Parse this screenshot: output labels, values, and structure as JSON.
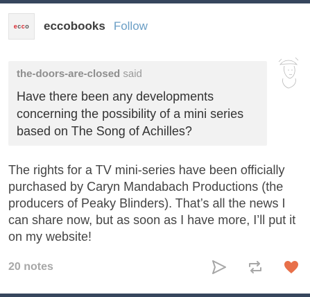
{
  "post": {
    "blog_name": "eccobooks",
    "follow_label": "Follow",
    "avatar_logo": "ecco"
  },
  "ask": {
    "asker": "the-doors-are-closed",
    "said_label": "said",
    "question": "Have there been any developments concerning the possibility of a mini series based on The Song of Achilles?"
  },
  "answer": {
    "text": "The rights for a TV mini-series have been officially purchased by Caryn Mandabach Productions (the producers of Peaky Blinders). That’s all the news I can share now, but as soon as I have more, I’ll put it on my website!"
  },
  "footer": {
    "notes": "20 notes",
    "icons": [
      "share-icon",
      "reblog-icon",
      "like-icon"
    ]
  },
  "colors": {
    "nav_bar": "#36465d",
    "follow_link": "#6a9ec5",
    "like_heart": "#e8704a",
    "ask_background": "#f2f2f2"
  }
}
